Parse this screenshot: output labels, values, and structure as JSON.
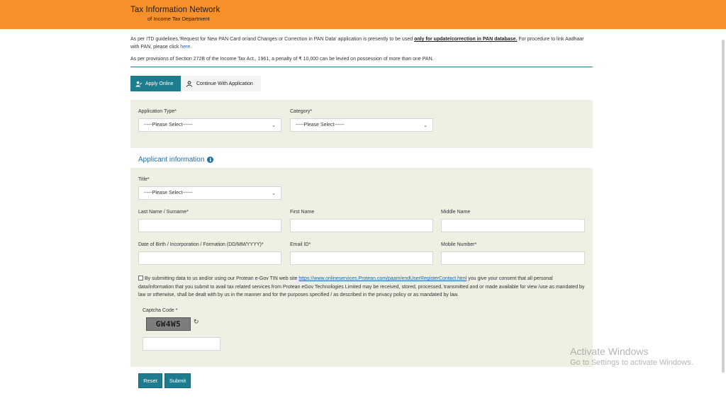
{
  "header": {
    "title": "Tax Information Network",
    "subtitle": "of Income Tax Department",
    "bg_color": "#f5902a"
  },
  "notices": {
    "line1_prefix": "As per ITD guidelines,'Request for New PAN Card or/and Changes or Correction in PAN Data' application is presently to be used ",
    "line1_bold": "only for update/correction in PAN database.",
    "line1_suffix": " For procedure to link Aadhaar with PAN, please click ",
    "line1_link": "here.",
    "line2": "As per provisions of Section 272B of the Income Tax Act., 1961, a penalty of ₹ 10,000 can be levied on possession of more than one PAN."
  },
  "tabs": [
    {
      "label": "Apply Online",
      "icon": "person-edit-icon",
      "active": true
    },
    {
      "label": "Continue With Application",
      "icon": "person-icon",
      "active": false
    }
  ],
  "application": {
    "type_label": "Application Type*",
    "type_value": "-----Please Select------",
    "category_label": "Category*",
    "category_value": "-----Please Select------"
  },
  "applicant": {
    "section_title": "Applicant information",
    "title_label": "Title*",
    "title_value": "-----Please Select------",
    "last_name_label": "Last Name / Surname*",
    "first_name_label": "First Name",
    "middle_name_label": "Middle Name",
    "dob_label": "Date of Birth / Incorporation / Formation (DD/MM/YYYY)*",
    "email_label": "Email ID*",
    "mobile_label": "Mobile Number*"
  },
  "consent": {
    "prefix": "By submitting data to us and/or using our Protean e-Gov TIN web site ",
    "link": "https://www.onlineservices.Protean.com/paam/endUserRegisterContact.html",
    "suffix": " you give your consent that all personal data/information that you submit to avail tax related services from Protean eGov Technologies Limited may be received, stored, processed, transmitted and or made available for view /use as mandated by law or otherwise, shall be dealt with by us in the manner and for the purposes specified / as described in the privacy policy or as mandated by law."
  },
  "captcha": {
    "label": "Captcha Code *",
    "code": "GW4W5"
  },
  "buttons": {
    "reset": "Reset",
    "submit": "Submit",
    "color": "#1e7c8f"
  },
  "watermark": {
    "line1": "Activate Windows",
    "line2": "Go to Settings to activate Windows."
  }
}
